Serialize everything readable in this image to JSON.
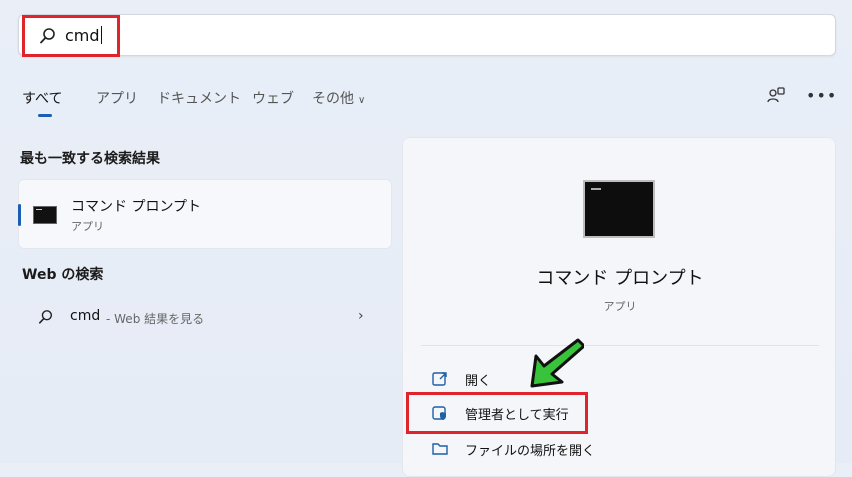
{
  "search": {
    "query": "cmd"
  },
  "tabs": [
    {
      "label": "すべて"
    },
    {
      "label": "アプリ"
    },
    {
      "label": "ドキュメント"
    },
    {
      "label": "ウェブ"
    },
    {
      "label": "その他"
    }
  ],
  "best_match": {
    "section_title": "最も一致する検索結果",
    "title": "コマンド プロンプト",
    "subtitle": "アプリ"
  },
  "web_search": {
    "section_title": "Web の検索",
    "query": "cmd",
    "suffix": " - Web 結果を見る"
  },
  "preview": {
    "title": "コマンド プロンプト",
    "subtitle": "アプリ",
    "actions": [
      {
        "label": "開く",
        "icon": "open-external-icon"
      },
      {
        "label": "管理者として実行",
        "icon": "admin-shield-icon"
      },
      {
        "label": "ファイルの場所を開く",
        "icon": "folder-icon"
      }
    ]
  },
  "colors": {
    "highlight": "#e0242b",
    "accent": "#1a5fb4",
    "arrow": "#39c33a"
  }
}
